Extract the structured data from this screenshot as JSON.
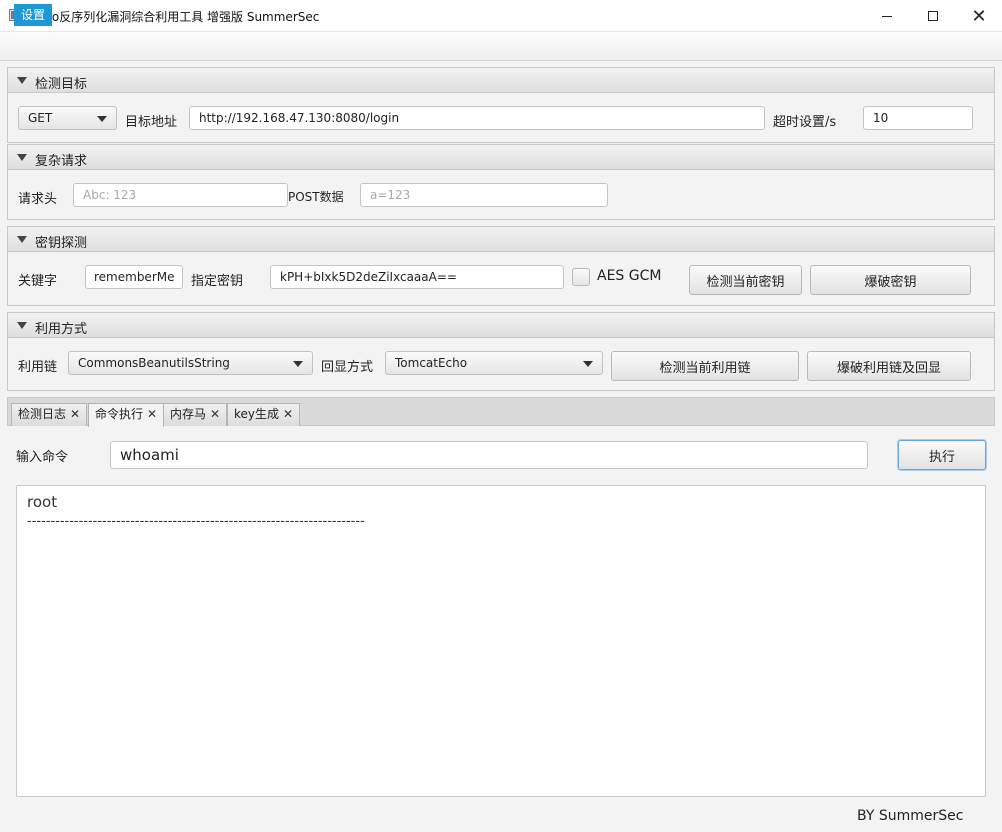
{
  "window": {
    "title": "shiro反序列化漏洞综合利用工具 增强版 SummerSec"
  },
  "menu": {
    "settings": "设置"
  },
  "target": {
    "title": "检测目标",
    "method": "GET",
    "url_label": "目标地址",
    "url": "http://192.168.47.130:8080/login",
    "timeout_label": "超时设置/s",
    "timeout": "10"
  },
  "request": {
    "title": "复杂请求",
    "header_label": "请求头",
    "header_placeholder": "Abc: 123",
    "post_label": "POST数据",
    "post_placeholder": "a=123"
  },
  "key": {
    "title": "密钥探测",
    "keyword_label": "关键字",
    "keyword": "rememberMe",
    "key_label": "指定密钥",
    "key_value": "kPH+bIxk5D2deZiIxcaaaA==",
    "aes_gcm_label": "AES GCM",
    "aes_gcm_checked": false,
    "detect_key_button": "检测当前密钥",
    "brute_key_button": "爆破密钥"
  },
  "exploit": {
    "title": "利用方式",
    "chain_label": "利用链",
    "chain": "CommonsBeanutilsString",
    "echo_label": "回显方式",
    "echo": "TomcatEcho",
    "detect_chain_button": "检测当前利用链",
    "brute_chain_button": "爆破利用链及回显"
  },
  "tabs": [
    {
      "label": "检测日志",
      "active": false
    },
    {
      "label": "命令执行",
      "active": true
    },
    {
      "label": "内存马",
      "active": false
    },
    {
      "label": "key生成",
      "active": false
    }
  ],
  "command": {
    "input_label": "输入命令",
    "input_value": "whoami",
    "execute_button": "执行"
  },
  "output": {
    "line1": "root",
    "line2": "------------------------------------------------------------------------"
  },
  "footer": "BY   SummerSec",
  "colors": {
    "accent": "#1e98d4"
  }
}
